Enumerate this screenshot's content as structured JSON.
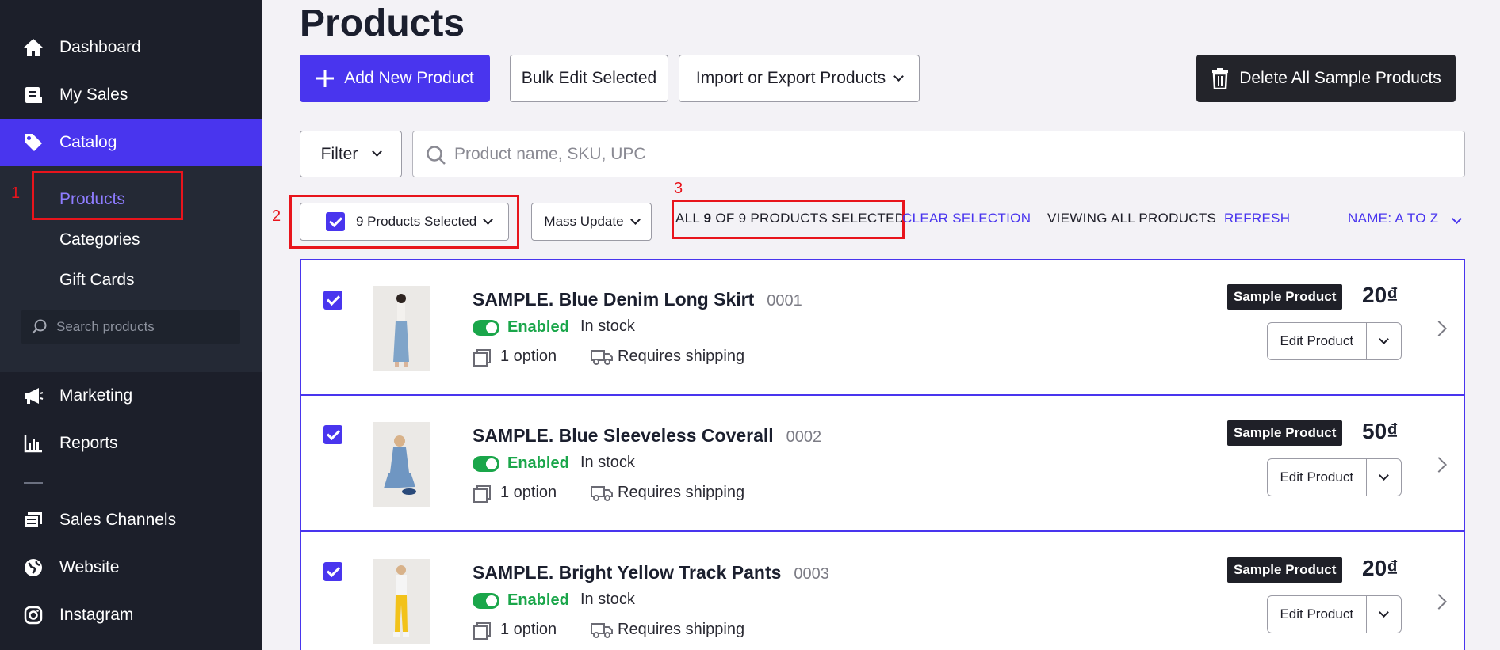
{
  "sidebar": {
    "items": [
      {
        "label": "Dashboard",
        "icon": "home-icon"
      },
      {
        "label": "My Sales",
        "icon": "sales-icon"
      },
      {
        "label": "Catalog",
        "icon": "tag-icon"
      },
      {
        "label": "Marketing",
        "icon": "megaphone-icon"
      },
      {
        "label": "Reports",
        "icon": "bar-chart-icon"
      },
      {
        "label": "Sales Channels",
        "icon": "channels-icon"
      },
      {
        "label": "Website",
        "icon": "globe-icon"
      },
      {
        "label": "Instagram",
        "icon": "instagram-icon"
      }
    ],
    "subitems": [
      "Products",
      "Categories",
      "Gift Cards"
    ],
    "search_placeholder": "Search products"
  },
  "page": {
    "title": "Products"
  },
  "toolbar": {
    "add_label": "Add New Product",
    "bulk_label": "Bulk Edit Selected",
    "import_label": "Import or Export Products",
    "delete_label": "Delete All Sample Products"
  },
  "filter": {
    "label": "Filter",
    "search_placeholder": "Product name, SKU, UPC"
  },
  "selection": {
    "selected_label": "9 Products Selected",
    "mass_update_label": "Mass Update",
    "status_prefix": "ALL",
    "status_count": "9",
    "status_suffix": "OF 9 PRODUCTS SELECTED",
    "clear_label": "CLEAR SELECTION",
    "viewing_label": "VIEWING ALL PRODUCTS",
    "refresh_label": "REFRESH",
    "sort_label": "NAME: A TO Z"
  },
  "annotations": [
    "1",
    "2",
    "3"
  ],
  "colors": {
    "accent": "#4935ee",
    "sidebar_bg": "#1c1f2a",
    "enabled_green": "#1aa64a",
    "highlight_red": "#e8141c"
  },
  "products": [
    {
      "name": "SAMPLE. Blue Denim Long Skirt",
      "sku": "0001",
      "status": "Enabled",
      "stock": "In stock",
      "options": "1 option",
      "shipping": "Requires shipping",
      "badge": "Sample Product",
      "price": "20₫",
      "edit_label": "Edit Product"
    },
    {
      "name": "SAMPLE. Blue Sleeveless Coverall",
      "sku": "0002",
      "status": "Enabled",
      "stock": "In stock",
      "options": "1 option",
      "shipping": "Requires shipping",
      "badge": "Sample Product",
      "price": "50₫",
      "edit_label": "Edit Product"
    },
    {
      "name": "SAMPLE. Bright Yellow Track Pants",
      "sku": "0003",
      "status": "Enabled",
      "stock": "In stock",
      "options": "1 option",
      "shipping": "Requires shipping",
      "badge": "Sample Product",
      "price": "20₫",
      "edit_label": "Edit Product"
    }
  ]
}
